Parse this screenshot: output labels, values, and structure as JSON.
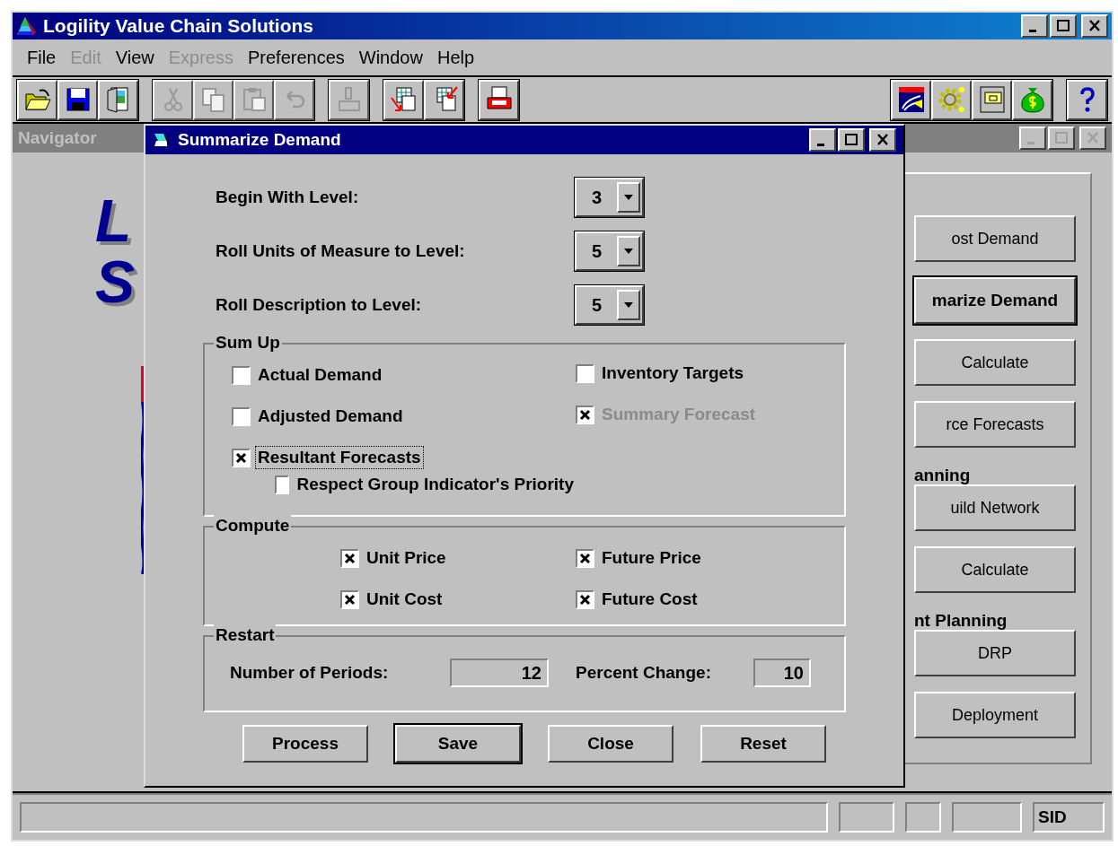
{
  "app": {
    "title": "Logility Value Chain Solutions"
  },
  "menu": [
    {
      "label": "File",
      "disabled": false
    },
    {
      "label": "Edit",
      "disabled": true
    },
    {
      "label": "View",
      "disabled": false
    },
    {
      "label": "Express",
      "disabled": true
    },
    {
      "label": "Preferences",
      "disabled": false
    },
    {
      "label": "Window",
      "disabled": false
    },
    {
      "label": "Help",
      "disabled": false
    }
  ],
  "toolbar": {
    "left_groups": [
      [
        {
          "kind": "open",
          "disabled": false
        },
        {
          "kind": "save",
          "disabled": false
        },
        {
          "kind": "exit",
          "disabled": false
        }
      ],
      [
        {
          "kind": "cut",
          "disabled": true
        },
        {
          "kind": "copy",
          "disabled": true
        },
        {
          "kind": "paste",
          "disabled": true
        },
        {
          "kind": "undo",
          "disabled": true
        }
      ],
      [
        {
          "kind": "stamp",
          "disabled": true
        }
      ],
      [
        {
          "kind": "table-out",
          "disabled": false
        },
        {
          "kind": "table-in",
          "disabled": false
        }
      ],
      [
        {
          "kind": "printer",
          "disabled": false
        }
      ]
    ],
    "right_groups": [
      [
        {
          "kind": "chart",
          "disabled": false
        },
        {
          "kind": "gear",
          "disabled": false
        },
        {
          "kind": "cabinet",
          "disabled": false
        },
        {
          "kind": "money",
          "disabled": false
        }
      ],
      [
        {
          "kind": "help",
          "disabled": false
        }
      ]
    ]
  },
  "navigator": {
    "title": "Navigator",
    "logo_lines": [
      "L",
      "S"
    ],
    "items": [
      {
        "kind": "button",
        "label": "ost Demand",
        "default": false
      },
      {
        "kind": "button",
        "label": "marize Demand",
        "default": true
      },
      {
        "kind": "button",
        "label": "Calculate",
        "default": false
      },
      {
        "kind": "button",
        "label": "rce Forecasts",
        "default": false
      },
      {
        "kind": "heading",
        "label": "anning"
      },
      {
        "kind": "button",
        "label": "uild Network",
        "default": false
      },
      {
        "kind": "button",
        "label": "Calculate",
        "default": false
      },
      {
        "kind": "heading",
        "label": "nt Planning"
      },
      {
        "kind": "button",
        "label": "DRP",
        "default": false
      },
      {
        "kind": "button",
        "label": "Deployment",
        "default": false
      }
    ]
  },
  "dialog": {
    "title": "Summarize Demand",
    "levels": [
      {
        "label": "Begin With Level:",
        "value": "3"
      },
      {
        "label": "Roll Units of Measure to Level:",
        "value": "5"
      },
      {
        "label": "Roll Description to Level:",
        "value": "5"
      }
    ],
    "sum_up": {
      "title": "Sum Up",
      "left": [
        {
          "label": "Actual Demand",
          "checked": false,
          "disabled": false,
          "focused": false
        },
        {
          "label": "Adjusted Demand",
          "checked": false,
          "disabled": false,
          "focused": false
        },
        {
          "label": "Resultant Forecasts",
          "checked": true,
          "disabled": false,
          "focused": true,
          "children": [
            {
              "label": "Respect Group Indicator's Priority",
              "checked": false,
              "disabled": false,
              "focused": false
            }
          ]
        }
      ],
      "right": [
        {
          "label": "Inventory Targets",
          "checked": false,
          "disabled": false,
          "focused": false
        },
        {
          "label": "Summary Forecast",
          "checked": true,
          "disabled": true,
          "focused": false
        }
      ]
    },
    "compute": {
      "title": "Compute",
      "left": [
        {
          "label": "Unit Price",
          "checked": true
        },
        {
          "label": "Unit Cost",
          "checked": true
        }
      ],
      "right": [
        {
          "label": "Future Price",
          "checked": true
        },
        {
          "label": "Future Cost",
          "checked": true
        }
      ]
    },
    "restart": {
      "title": "Restart",
      "fields": [
        {
          "label": "Number of Periods:",
          "value": "12"
        },
        {
          "label": "Percent Change:",
          "value": "10"
        }
      ]
    },
    "buttons": [
      {
        "label": "Process",
        "default": false
      },
      {
        "label": "Save",
        "default": true
      },
      {
        "label": "Close",
        "default": false
      },
      {
        "label": "Reset",
        "default": false
      }
    ]
  },
  "status_bar": {
    "text": "SID"
  }
}
